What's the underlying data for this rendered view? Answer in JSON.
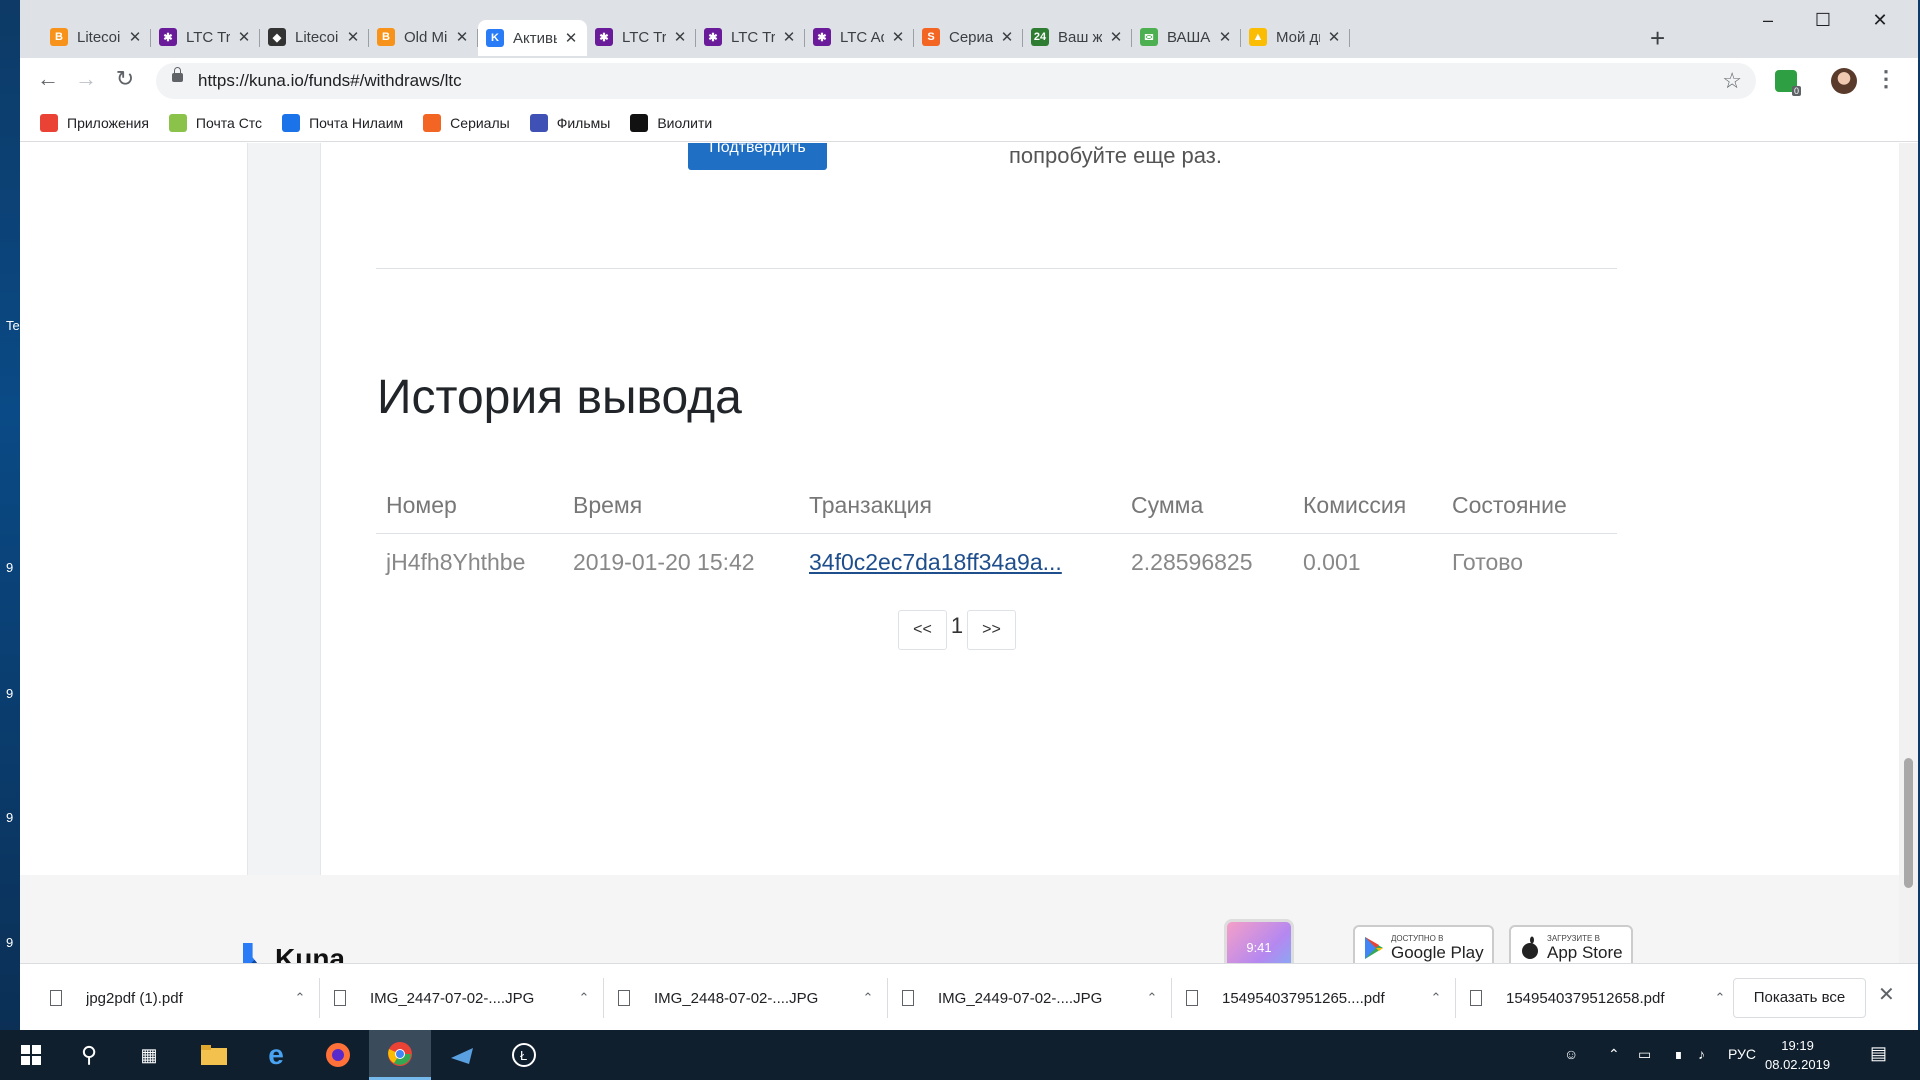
{
  "desktop": {
    "edge_labels": [
      "Te",
      "9",
      "9",
      "9",
      "9"
    ]
  },
  "browser": {
    "tabs": [
      {
        "title": "Litecoin",
        "color": "#f7931a",
        "glyph": "B"
      },
      {
        "title": "LTC Tran",
        "color": "#6a1b9a",
        "glyph": "✱"
      },
      {
        "title": "Litecoin",
        "color": "#333333",
        "glyph": "◆"
      },
      {
        "title": "Old Min",
        "color": "#f7931a",
        "glyph": "B"
      },
      {
        "title": "Активы",
        "color": "#2a7cf6",
        "glyph": "K"
      },
      {
        "title": "LTC Tran",
        "color": "#6a1b9a",
        "glyph": "✱"
      },
      {
        "title": "LTC Tran",
        "color": "#6a1b9a",
        "glyph": "✱"
      },
      {
        "title": "LTC Add",
        "color": "#6a1b9a",
        "glyph": "✱"
      },
      {
        "title": "Сериал",
        "color": "#f26522",
        "glyph": "S"
      },
      {
        "title": "Ваш жи",
        "color": "#2e7d32",
        "glyph": "24"
      },
      {
        "title": "ВАША Г",
        "color": "#4caf50",
        "glyph": "✉"
      },
      {
        "title": "Мой ди",
        "color": "#fbbc04",
        "glyph": "▲"
      }
    ],
    "active_tab_index": 4,
    "new_tab": "+",
    "url": "https://kuna.io/funds#/withdraws/ltc",
    "extension_badge": "0",
    "bookmarks": [
      {
        "label": "Приложения",
        "color": "#ea4335"
      },
      {
        "label": "Почта Стс",
        "color": "#8bc34a"
      },
      {
        "label": "Почта Нилаим",
        "color": "#1a73e8"
      },
      {
        "label": "Сериалы",
        "color": "#f26522"
      },
      {
        "label": "Фильмы",
        "color": "#3f51b5"
      },
      {
        "label": "Виолити",
        "color": "#111111"
      }
    ]
  },
  "page": {
    "confirm_button": "Подтвердить",
    "retry_text": "попробуйте еще раз.",
    "history_title": "История вывода",
    "table": {
      "headers": [
        "Номер",
        "Время",
        "Транзакция",
        "Сумма",
        "Комиссия",
        "Состояние"
      ],
      "rows": [
        {
          "id": "jH4fh8Yhthbe",
          "time": "2019-01-20 15:42",
          "tx": "34f0c2ec7da18ff34a9a...",
          "amount": "2.28596825",
          "fee": "0.001",
          "status": "Готово"
        }
      ]
    },
    "pager": {
      "prev": "<<",
      "current": "1",
      "next": ">>"
    },
    "footer": {
      "brand": "Kuna",
      "phone_time": "9:41",
      "google_small": "ДОСТУПНО В",
      "google_big": "Google Play",
      "apple_small": "Загрузите в",
      "apple_big": "App Store"
    }
  },
  "downloads": {
    "items": [
      "jpg2pdf (1).pdf",
      "IMG_2447-07-02-....JPG",
      "IMG_2448-07-02-....JPG",
      "IMG_2449-07-02-....JPG",
      "154954037951265....pdf",
      "1549540379512658.pdf"
    ],
    "show_all": "Показать все"
  },
  "taskbar": {
    "lang": "РУС",
    "time": "19:19",
    "date": "08.02.2019"
  }
}
